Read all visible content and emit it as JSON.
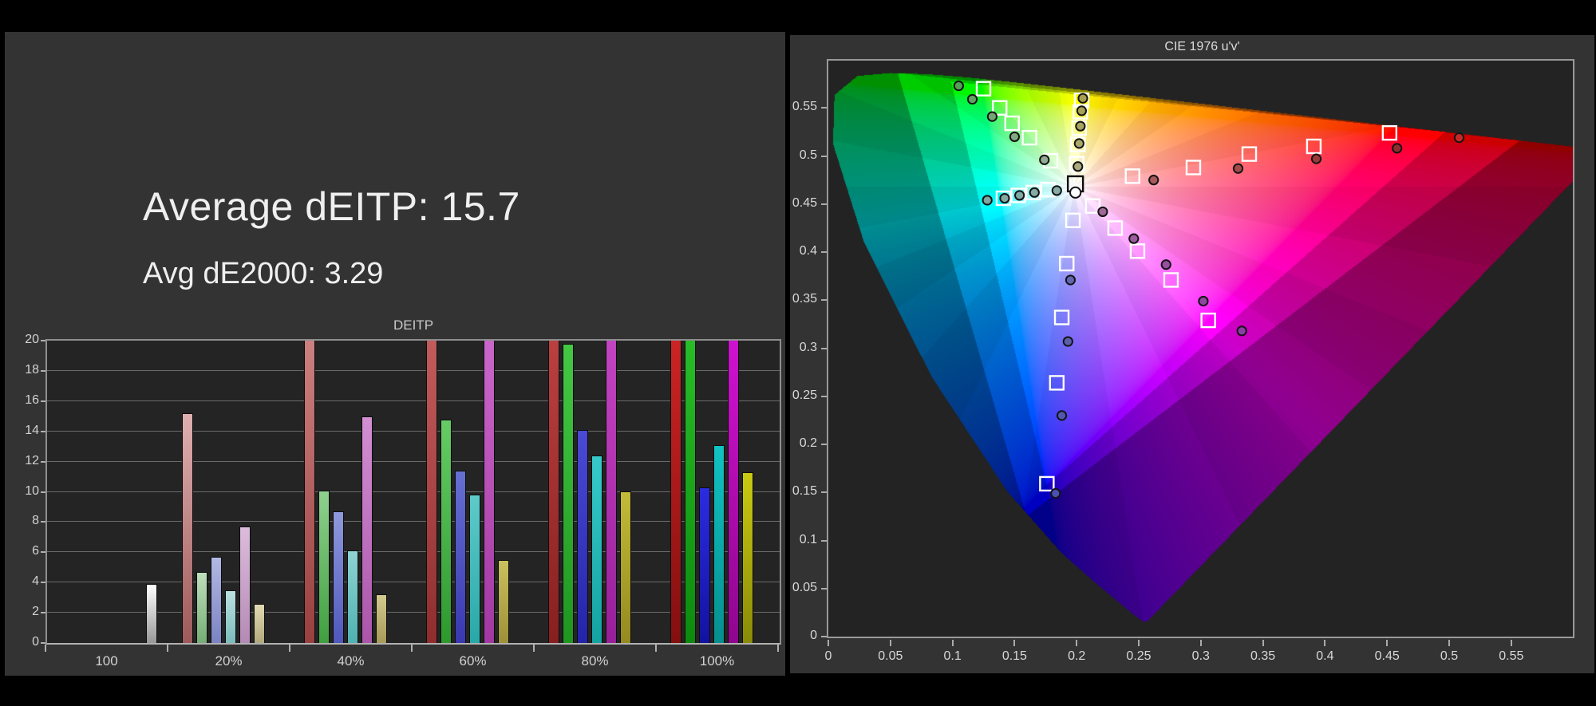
{
  "left_panel": {
    "heading_primary": "Average dEITP: 15.7",
    "heading_secondary": "Avg dE2000: 3.29"
  },
  "chart_data": [
    {
      "type": "bar",
      "title": "DEITP",
      "ylim": [
        0,
        20
      ],
      "ytick_step": 2,
      "grid": true,
      "categories": [
        "100",
        "20%",
        "40%",
        "60%",
        "80%",
        "100%"
      ],
      "series_order": [
        "red",
        "green",
        "blue",
        "cyan",
        "magenta",
        "yellow",
        "white"
      ],
      "groups": [
        {
          "label": "100",
          "bars": [
            {
              "series": "white",
              "slot": 6,
              "value": 3.9,
              "clipped": false,
              "color_top": "#ffffff",
              "color_bottom": "#989898"
            }
          ]
        },
        {
          "label": "20%",
          "bars": [
            {
              "series": "red",
              "slot": 0,
              "value": 15.2,
              "clipped": false,
              "color_top": "#dfafaf",
              "color_bottom": "#9e5a5a"
            },
            {
              "series": "green",
              "slot": 1,
              "value": 4.7,
              "clipped": false,
              "color_top": "#bfe0bb",
              "color_bottom": "#76ad76"
            },
            {
              "series": "blue",
              "slot": 2,
              "value": 5.7,
              "clipped": false,
              "color_top": "#b3b9e4",
              "color_bottom": "#7b83c4"
            },
            {
              "series": "cyan",
              "slot": 3,
              "value": 3.5,
              "clipped": false,
              "color_top": "#bce0e0",
              "color_bottom": "#7cbcbc"
            },
            {
              "series": "magenta",
              "slot": 4,
              "value": 7.7,
              "clipped": false,
              "color_top": "#dcbcdc",
              "color_bottom": "#b48ab4"
            },
            {
              "series": "yellow",
              "slot": 5,
              "value": 2.6,
              "clipped": false,
              "color_top": "#e0dab4",
              "color_bottom": "#b2aa7c"
            }
          ]
        },
        {
          "label": "40%",
          "bars": [
            {
              "series": "red",
              "slot": 0,
              "value": 20,
              "clipped": true,
              "color_top": "#cc8080",
              "color_bottom": "#993f3f"
            },
            {
              "series": "green",
              "slot": 1,
              "value": 10.1,
              "clipped": false,
              "color_top": "#8fd08f",
              "color_bottom": "#3fa03f"
            },
            {
              "series": "blue",
              "slot": 2,
              "value": 8.7,
              "clipped": false,
              "color_top": "#9099dc",
              "color_bottom": "#4f58bc"
            },
            {
              "series": "cyan",
              "slot": 3,
              "value": 6.1,
              "clipped": false,
              "color_top": "#8fd2d2",
              "color_bottom": "#4fb2b2"
            },
            {
              "series": "magenta",
              "slot": 4,
              "value": 15.0,
              "clipped": false,
              "color_top": "#d28fd2",
              "color_bottom": "#aa55aa"
            },
            {
              "series": "yellow",
              "slot": 5,
              "value": 3.2,
              "clipped": false,
              "color_top": "#d2ca8f",
              "color_bottom": "#a89a58"
            }
          ]
        },
        {
          "label": "60%",
          "bars": [
            {
              "series": "red",
              "slot": 0,
              "value": 20,
              "clipped": true,
              "color_top": "#c25c5c",
              "color_bottom": "#8f2d2d"
            },
            {
              "series": "green",
              "slot": 1,
              "value": 14.8,
              "clipped": false,
              "color_top": "#66cc66",
              "color_bottom": "#2d992d"
            },
            {
              "series": "blue",
              "slot": 2,
              "value": 11.4,
              "clipped": false,
              "color_top": "#6670d2",
              "color_bottom": "#3838b0"
            },
            {
              "series": "cyan",
              "slot": 3,
              "value": 9.8,
              "clipped": false,
              "color_top": "#5ecaca",
              "color_bottom": "#28a8a8"
            },
            {
              "series": "magenta",
              "slot": 4,
              "value": 20,
              "clipped": true,
              "color_top": "#ca66ca",
              "color_bottom": "#a238a2"
            },
            {
              "series": "yellow",
              "slot": 5,
              "value": 5.5,
              "clipped": false,
              "color_top": "#cac05e",
              "color_bottom": "#9e9038"
            }
          ]
        },
        {
          "label": "80%",
          "bars": [
            {
              "series": "red",
              "slot": 0,
              "value": 20,
              "clipped": true,
              "color_top": "#bb4040",
              "color_bottom": "#881f1f"
            },
            {
              "series": "green",
              "slot": 1,
              "value": 19.8,
              "clipped": false,
              "color_top": "#44c844",
              "color_bottom": "#1f961f"
            },
            {
              "series": "blue",
              "slot": 2,
              "value": 14.1,
              "clipped": false,
              "color_top": "#4a4ad4",
              "color_bottom": "#2424aa"
            },
            {
              "series": "cyan",
              "slot": 3,
              "value": 12.4,
              "clipped": false,
              "color_top": "#38caca",
              "color_bottom": "#14a2a2"
            },
            {
              "series": "magenta",
              "slot": 4,
              "value": 20,
              "clipped": true,
              "color_top": "#c244c2",
              "color_bottom": "#991f99"
            },
            {
              "series": "yellow",
              "slot": 5,
              "value": 10.0,
              "clipped": false,
              "color_top": "#c2ba38",
              "color_bottom": "#948a1f"
            }
          ]
        },
        {
          "label": "100%",
          "bars": [
            {
              "series": "red",
              "slot": 0,
              "value": 20,
              "clipped": true,
              "color_top": "#cc2424",
              "color_bottom": "#840f0f"
            },
            {
              "series": "green",
              "slot": 1,
              "value": 20,
              "clipped": true,
              "color_top": "#28bc28",
              "color_bottom": "#0d8a0d"
            },
            {
              "series": "blue",
              "slot": 2,
              "value": 10.3,
              "clipped": false,
              "color_top": "#2c2ce0",
              "color_bottom": "#1212a0"
            },
            {
              "series": "cyan",
              "slot": 3,
              "value": 13.1,
              "clipped": false,
              "color_top": "#12c2c2",
              "color_bottom": "#068f8f"
            },
            {
              "series": "magenta",
              "slot": 4,
              "value": 20,
              "clipped": true,
              "color_top": "#ce12ce",
              "color_bottom": "#8f068f"
            },
            {
              "series": "yellow",
              "slot": 5,
              "value": 11.3,
              "clipped": false,
              "color_top": "#caca12",
              "color_bottom": "#8a8a06"
            }
          ]
        }
      ]
    },
    {
      "type": "scatter",
      "title": "CIE 1976 u'v'",
      "x_range": [
        0,
        0.5996
      ],
      "y_range": [
        0,
        0.5992
      ],
      "tick_step": 0.05,
      "x_tick_labels": [
        "0",
        "0.05",
        "0.1",
        "0.15",
        "0.2",
        "0.25",
        "0.3",
        "0.35",
        "0.4",
        "0.45",
        "0.5",
        "0.55"
      ],
      "y_tick_labels": [
        "0",
        "0.05",
        "0.1",
        "0.15",
        "0.2",
        "0.25",
        "0.3",
        "0.35",
        "0.4",
        "0.45",
        "0.5",
        "0.55"
      ],
      "white_point": [
        0.1978,
        0.4683
      ],
      "gamut_p3": [
        [
          0.4964,
          0.5255
        ],
        [
          0.0986,
          0.5777
        ],
        [
          0.1754,
          0.1579
        ]
      ],
      "gamut_bt2020": [
        [
          0.5566,
          0.5165
        ],
        [
          0.0556,
          0.5868
        ],
        [
          0.1593,
          0.1258
        ]
      ],
      "dim_outside_p3": 0.78,
      "dim_outside_2020": 0.55,
      "locus_xy": [
        [
          0.1741,
          0.005
        ],
        [
          0.174,
          0.0049
        ],
        [
          0.1733,
          0.0048
        ],
        [
          0.1726,
          0.0048
        ],
        [
          0.1714,
          0.0051
        ],
        [
          0.1689,
          0.0069
        ],
        [
          0.1644,
          0.0109
        ],
        [
          0.1566,
          0.0177
        ],
        [
          0.144,
          0.0297
        ],
        [
          0.1241,
          0.0578
        ],
        [
          0.0913,
          0.1327
        ],
        [
          0.0454,
          0.295
        ],
        [
          0.0082,
          0.5384
        ],
        [
          0.0139,
          0.7502
        ],
        [
          0.0743,
          0.8338
        ],
        [
          0.1547,
          0.8059
        ],
        [
          0.2296,
          0.7543
        ],
        [
          0.3016,
          0.6923
        ],
        [
          0.3731,
          0.6245
        ],
        [
          0.4441,
          0.5547
        ],
        [
          0.5125,
          0.4866
        ],
        [
          0.5752,
          0.4242
        ],
        [
          0.627,
          0.3725
        ],
        [
          0.6658,
          0.334
        ],
        [
          0.6915,
          0.3083
        ],
        [
          0.7079,
          0.292
        ],
        [
          0.719,
          0.2809
        ],
        [
          0.726,
          0.274
        ],
        [
          0.73,
          0.27
        ],
        [
          0.732,
          0.268
        ],
        [
          0.7334,
          0.2666
        ],
        [
          0.7344,
          0.2656
        ],
        [
          0.7347,
          0.2653
        ]
      ],
      "marker_style": {
        "square_size": 17,
        "square_stroke": "#ffffff",
        "white_square_stroke": "#0d0d0d",
        "circle_r": 5.6,
        "circle_stroke": "#141414"
      },
      "targets": [
        {
          "series": "green",
          "u": 0.125,
          "v": 0.57
        },
        {
          "series": "green",
          "u": 0.138,
          "v": 0.55
        },
        {
          "series": "green",
          "u": 0.148,
          "v": 0.534
        },
        {
          "series": "green",
          "u": 0.162,
          "v": 0.519
        },
        {
          "series": "green",
          "u": 0.179,
          "v": 0.495
        },
        {
          "series": "yellow",
          "u": 0.204,
          "v": 0.558
        },
        {
          "series": "yellow",
          "u": 0.203,
          "v": 0.546
        },
        {
          "series": "yellow",
          "u": 0.202,
          "v": 0.529
        },
        {
          "series": "yellow",
          "u": 0.201,
          "v": 0.512
        },
        {
          "series": "yellow",
          "u": 0.2,
          "v": 0.492
        },
        {
          "series": "cyan",
          "u": 0.141,
          "v": 0.456
        },
        {
          "series": "cyan",
          "u": 0.153,
          "v": 0.459
        },
        {
          "series": "cyan",
          "u": 0.165,
          "v": 0.462
        },
        {
          "series": "cyan",
          "u": 0.177,
          "v": 0.465
        },
        {
          "series": "red",
          "u": 0.245,
          "v": 0.479
        },
        {
          "series": "red",
          "u": 0.294,
          "v": 0.488
        },
        {
          "series": "red",
          "u": 0.339,
          "v": 0.502
        },
        {
          "series": "red",
          "u": 0.391,
          "v": 0.51
        },
        {
          "series": "red",
          "u": 0.452,
          "v": 0.524
        },
        {
          "series": "magenta",
          "u": 0.213,
          "v": 0.448
        },
        {
          "series": "magenta",
          "u": 0.231,
          "v": 0.425
        },
        {
          "series": "magenta",
          "u": 0.249,
          "v": 0.401
        },
        {
          "series": "magenta",
          "u": 0.276,
          "v": 0.371
        },
        {
          "series": "magenta",
          "u": 0.306,
          "v": 0.329
        },
        {
          "series": "blue",
          "u": 0.197,
          "v": 0.433
        },
        {
          "series": "blue",
          "u": 0.192,
          "v": 0.388
        },
        {
          "series": "blue",
          "u": 0.188,
          "v": 0.332
        },
        {
          "series": "blue",
          "u": 0.184,
          "v": 0.264
        },
        {
          "series": "blue",
          "u": 0.176,
          "v": 0.159
        },
        {
          "series": "white",
          "u": 0.199,
          "v": 0.471,
          "white_target": true
        }
      ],
      "measurements": [
        {
          "series": "green",
          "u": 0.105,
          "v": 0.573,
          "fill": "#55a055"
        },
        {
          "series": "green",
          "u": 0.116,
          "v": 0.559,
          "fill": "#63a263"
        },
        {
          "series": "green",
          "u": 0.132,
          "v": 0.541,
          "fill": "#74a674"
        },
        {
          "series": "green",
          "u": 0.15,
          "v": 0.52,
          "fill": "#83a883"
        },
        {
          "series": "green",
          "u": 0.174,
          "v": 0.496,
          "fill": "#93ab93"
        },
        {
          "series": "yellow",
          "u": 0.205,
          "v": 0.56,
          "fill": "#a89f4f"
        },
        {
          "series": "yellow",
          "u": 0.204,
          "v": 0.547,
          "fill": "#a8a257"
        },
        {
          "series": "yellow",
          "u": 0.203,
          "v": 0.531,
          "fill": "#a9a560"
        },
        {
          "series": "yellow",
          "u": 0.202,
          "v": 0.513,
          "fill": "#aaa76b"
        },
        {
          "series": "yellow",
          "u": 0.201,
          "v": 0.489,
          "fill": "#abaa7d"
        },
        {
          "series": "cyan",
          "u": 0.128,
          "v": 0.454,
          "fill": "#7fa8a2"
        },
        {
          "series": "cyan",
          "u": 0.142,
          "v": 0.456,
          "fill": "#80a9a3"
        },
        {
          "series": "cyan",
          "u": 0.154,
          "v": 0.459,
          "fill": "#82aaa4"
        },
        {
          "series": "cyan",
          "u": 0.166,
          "v": 0.462,
          "fill": "#84aba5"
        },
        {
          "series": "cyan",
          "u": 0.184,
          "v": 0.464,
          "fill": "#86aca6"
        },
        {
          "series": "white",
          "u": 0.199,
          "v": 0.462,
          "fill": "#ffffff"
        },
        {
          "series": "red",
          "u": 0.262,
          "v": 0.475,
          "fill": "#a85a5a"
        },
        {
          "series": "red",
          "u": 0.33,
          "v": 0.487,
          "fill": "#a24a4a"
        },
        {
          "series": "red",
          "u": 0.393,
          "v": 0.497,
          "fill": "#9a3a3a"
        },
        {
          "series": "red",
          "u": 0.458,
          "v": 0.508,
          "fill": "#912c2c"
        },
        {
          "series": "red",
          "u": 0.508,
          "v": 0.519,
          "fill": "#c62828"
        },
        {
          "series": "magenta",
          "u": 0.221,
          "v": 0.442,
          "fill": "#a06898"
        },
        {
          "series": "magenta",
          "u": 0.246,
          "v": 0.414,
          "fill": "#9d5c9d"
        },
        {
          "series": "magenta",
          "u": 0.272,
          "v": 0.387,
          "fill": "#974f9f"
        },
        {
          "series": "magenta",
          "u": 0.302,
          "v": 0.349,
          "fill": "#9147a2"
        },
        {
          "series": "magenta",
          "u": 0.333,
          "v": 0.318,
          "fill": "#8b3fa5"
        },
        {
          "series": "blue",
          "u": 0.195,
          "v": 0.371,
          "fill": "#6166ae"
        },
        {
          "series": "blue",
          "u": 0.193,
          "v": 0.307,
          "fill": "#5a60ae"
        },
        {
          "series": "blue",
          "u": 0.188,
          "v": 0.23,
          "fill": "#5157ae"
        },
        {
          "series": "blue",
          "u": 0.183,
          "v": 0.149,
          "fill": "#4a51b0"
        }
      ]
    }
  ]
}
